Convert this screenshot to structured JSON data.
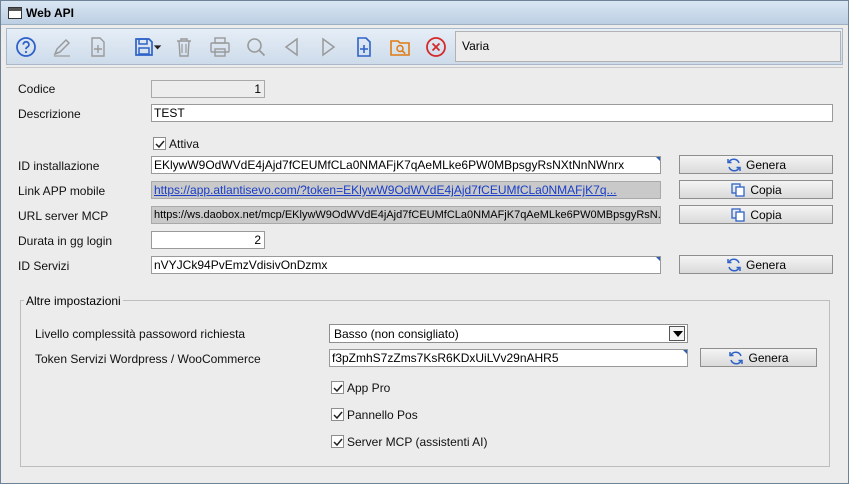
{
  "window": {
    "title": "Web API"
  },
  "toolbar": {
    "title_field": "Varia",
    "icons": [
      "help-icon",
      "edit-icon",
      "new-copy-icon",
      "save-icon",
      "delete-icon",
      "print-icon",
      "search-icon",
      "previous-icon",
      "next-icon",
      "new-document-icon",
      "folder-search-icon",
      "close-icon"
    ]
  },
  "form": {
    "codice": {
      "label": "Codice",
      "value": "1"
    },
    "descrizione": {
      "label": "Descrizione",
      "value": "TEST"
    },
    "attiva": {
      "label": "Attiva",
      "checked": true
    },
    "id_installazione": {
      "label": "ID installazione",
      "value": "EKlywW9OdWVdE4jAjd7fCEUMfCLa0NMAFjK7qAeMLke6PW0MBpsgyRsNXtNnNWnrx",
      "button": "Genera"
    },
    "link_app": {
      "label": "Link APP mobile",
      "value": "https://app.atlantisevo.com/?token=EKlywW9OdWVdE4jAjd7fCEUMfCLa0NMAFjK7q...",
      "button": "Copia"
    },
    "url_mcp": {
      "label": "URL server MCP",
      "value": "https://ws.daobox.net/mcp/EKlywW9OdWVdE4jAjd7fCEUMfCLa0NMAFjK7qAeMLke6PW0MBpsgyRsN...",
      "button": "Copia"
    },
    "durata": {
      "label": "Durata in gg login",
      "value": "2"
    },
    "id_servizi": {
      "label": "ID Servizi",
      "value": "nVYJCk94PvEmzVdisivOnDzmx",
      "button": "Genera"
    }
  },
  "altre": {
    "title": "Altre impostazioni",
    "livello": {
      "label": "Livello complessità passoword richiesta",
      "value": "Basso (non consigliato)"
    },
    "token": {
      "label": "Token Servizi Wordpress / WooCommerce",
      "value": "f3pZmhS7zZms7KsR6KDxUiLVv29nAHR5",
      "button": "Genera"
    },
    "app_pro": {
      "label": "App Pro",
      "checked": true
    },
    "pannello_pos": {
      "label": "Pannello Pos",
      "checked": true
    },
    "server_mcp": {
      "label": "Server MCP (assistenti AI)",
      "checked": true
    }
  }
}
